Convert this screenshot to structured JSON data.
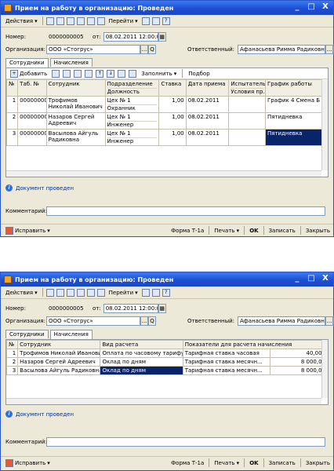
{
  "window": {
    "title": "Прием на работу в организацию: Проведен",
    "buttons": [
      "_",
      "□",
      "X"
    ]
  },
  "toolbar": {
    "actions_label": "Действия",
    "goto_label": "Перейти",
    "help_label": "?"
  },
  "header": {
    "number_label": "Номер:",
    "number_value": "0000000005",
    "from_label": "от:",
    "date_value": "08.02.2011 12:00:00",
    "org_label": "Организация:",
    "org_value": "ООО «Стогрус»",
    "resp_label": "Ответственный:",
    "resp_value": "Афанасьева Римма Радиковна"
  },
  "tabs": [
    "Сотрудники",
    "Начисления"
  ],
  "employees_toolbar": {
    "add_label": "Добавить",
    "fill_label": "Заполнить",
    "pick_label": "Подбор"
  },
  "employees": {
    "headers": {
      "num": "№",
      "tab": "Таб. №",
      "emp": "Сотрудник",
      "dept": "Подразделение",
      "pos": "Должность",
      "rate": "Ставка",
      "date": "Дата приема",
      "test": "Испытатель...",
      "cond": "Условия пр...",
      "sched": "График работы"
    },
    "rows": [
      {
        "n": "1",
        "tab": "00000000...",
        "name": "Трофимов Николай Иванович",
        "dept": "Цех № 1",
        "pos": "Охранник",
        "rate": "1,00",
        "date": "08.02.2011",
        "sched": "График 4 Смена Б"
      },
      {
        "n": "2",
        "tab": "00000000...",
        "name": "Назаров Сергей Адреевич",
        "dept": "Цех № 1",
        "pos": "Инженер",
        "rate": "1,00",
        "date": "08.02.2011",
        "sched": "Пятидневка"
      },
      {
        "n": "3",
        "tab": "00000000...",
        "name": "Васылова Айгуль Радиковна",
        "dept": "Цех № 1",
        "pos": "Инженер",
        "rate": "1,00",
        "date": "08.02.2011",
        "sched": "Пятидневка"
      }
    ]
  },
  "accruals": {
    "headers": {
      "num": "№",
      "emp": "Сотрудник",
      "kind": "Вид расчета",
      "indic": "Показатели для расчета начисления"
    },
    "rows": [
      {
        "n": "1",
        "name": "Трофимов Николай Иванович",
        "kind": "Оплата по часовому тарифу",
        "indic": "Тарифная ставка часовая",
        "value": "40,000"
      },
      {
        "n": "2",
        "name": "Назаров Сергей Адреевич",
        "kind": "Оклад по дням",
        "indic": "Тарифная ставка месячн...",
        "value": "8 000,00"
      },
      {
        "n": "3",
        "name": "Васылова Айгуль Радиковна",
        "kind": "Оклад по дням",
        "indic": "Тарифная ставка месячн...",
        "value": "8 000,00"
      }
    ]
  },
  "status_text": "Документ проведен",
  "comment_label": "Комментарий:",
  "comment_value": "",
  "bottom": {
    "fix_label": "Исправить",
    "form_label": "Форма Т-1а",
    "print_label": "Печать",
    "ok_label": "OK",
    "save_label": "Записать",
    "close_label": "Закрыть"
  }
}
